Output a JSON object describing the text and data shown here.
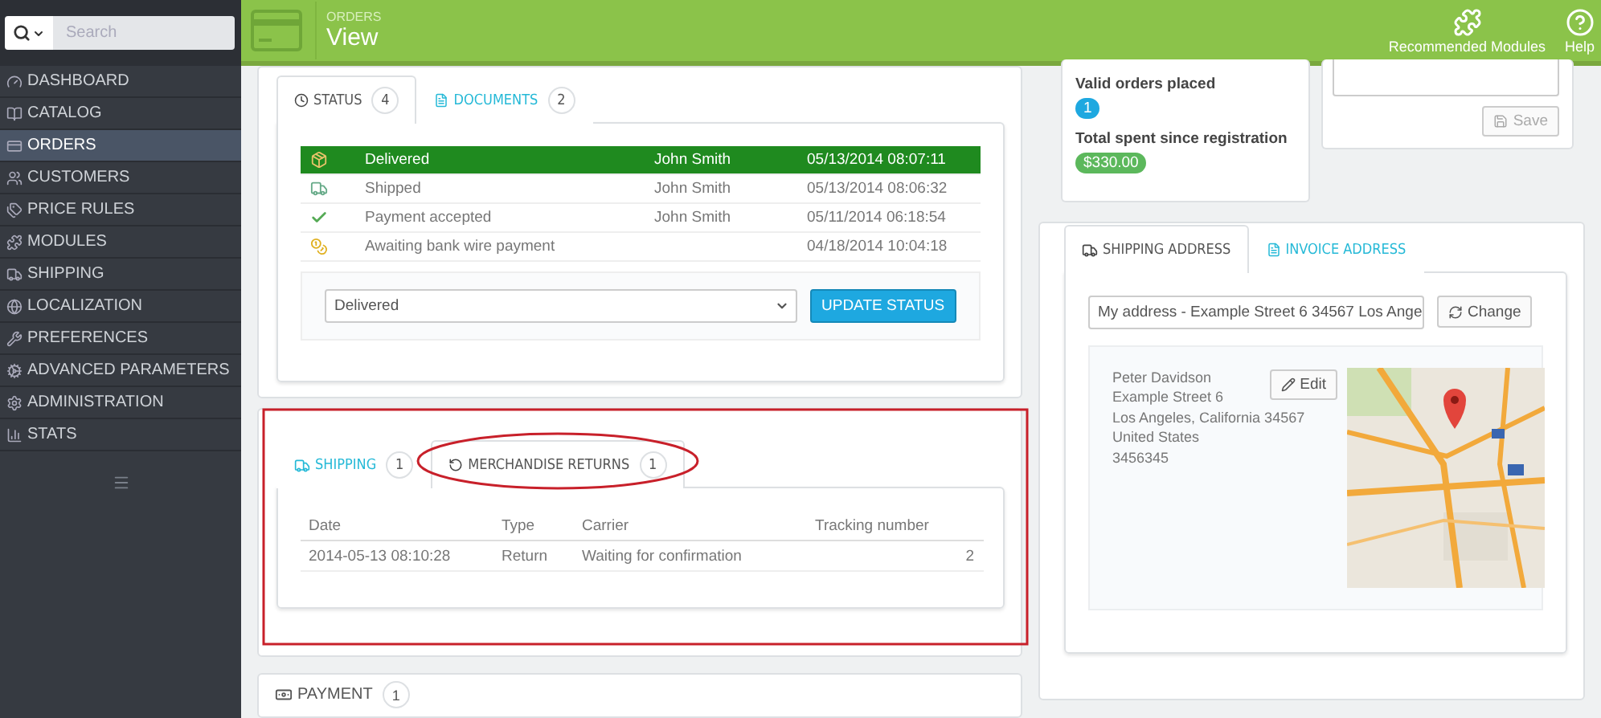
{
  "search": {
    "placeholder": "Search"
  },
  "sidebar": {
    "items": [
      {
        "label": "DASHBOARD",
        "selected": false
      },
      {
        "label": "CATALOG",
        "selected": false
      },
      {
        "label": "ORDERS",
        "selected": true
      },
      {
        "label": "CUSTOMERS",
        "selected": false
      },
      {
        "label": "PRICE RULES",
        "selected": false
      },
      {
        "label": "MODULES",
        "selected": false
      },
      {
        "label": "SHIPPING",
        "selected": false
      },
      {
        "label": "LOCALIZATION",
        "selected": false
      },
      {
        "label": "PREFERENCES",
        "selected": false
      },
      {
        "label": "ADVANCED PARAMETERS",
        "selected": false
      },
      {
        "label": "ADMINISTRATION",
        "selected": false
      },
      {
        "label": "STATS",
        "selected": false
      }
    ]
  },
  "header": {
    "breadcrumb": "ORDERS",
    "title": "View",
    "actions": [
      {
        "label": "Recommended Modules",
        "kind": "modules"
      },
      {
        "label": "Help",
        "kind": "help"
      }
    ]
  },
  "status_panel": {
    "tabs": [
      {
        "label": "STATUS",
        "count": "4",
        "selected": true
      },
      {
        "label": "DOCUMENTS",
        "count": "2",
        "selected": false
      }
    ],
    "history": [
      {
        "status": "Delivered",
        "employee": "John Smith",
        "date": "05/13/2014 08:07:11",
        "current": true
      },
      {
        "status": "Shipped",
        "employee": "John Smith",
        "date": "05/13/2014 08:06:32",
        "current": false
      },
      {
        "status": "Payment accepted",
        "employee": "John Smith",
        "date": "05/11/2014 06:18:54",
        "current": false
      },
      {
        "status": "Awaiting bank wire payment",
        "date": "04/18/2014 10:04:18",
        "current": false
      }
    ],
    "status_select": "Delivered",
    "update_button": "UPDATE STATUS"
  },
  "shipping_panel": {
    "tabs": [
      {
        "label": "SHIPPING",
        "count": "1",
        "selected": false
      },
      {
        "label": "MERCHANDISE RETURNS",
        "count": "1",
        "selected": true
      }
    ],
    "columns": [
      "Date",
      "Type",
      "Carrier",
      "Tracking number"
    ],
    "rows": [
      [
        "2014-05-13 08:10:28",
        "Return",
        "Waiting for confirmation",
        "2"
      ]
    ]
  },
  "payment_panel": {
    "label": "PAYMENT",
    "count": "1"
  },
  "customer": {
    "orders_label": "Valid orders placed",
    "orders_count": "1",
    "spent_label": "Total spent since registration",
    "spent_amount": "$330.00"
  },
  "note": {
    "save_button": "Save"
  },
  "address_panel": {
    "tabs": [
      {
        "label": "SHIPPING ADDRESS",
        "selected": true
      },
      {
        "label": "INVOICE ADDRESS",
        "selected": false
      }
    ],
    "address_select": "My address - Example Street 6 34567 Los Ange",
    "change_button": "Change",
    "edit_button": "Edit",
    "address_lines": [
      "Peter Davidson",
      "Example Street 6",
      "Los Angeles, California 34567",
      "United States",
      "3456345"
    ]
  }
}
